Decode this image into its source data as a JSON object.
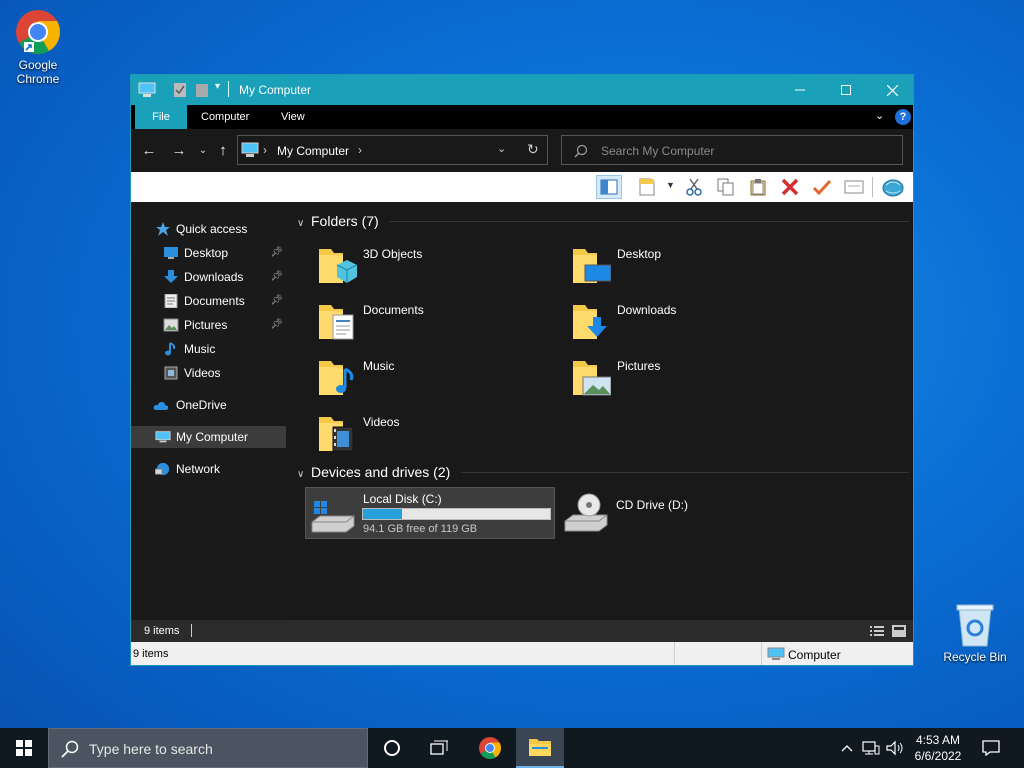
{
  "desktop": {
    "chrome_label": "Google Chrome",
    "recycle_label": "Recycle Bin"
  },
  "window": {
    "title": "My Computer",
    "ribbon_tabs": [
      {
        "label": "File",
        "active": true
      },
      {
        "label": "Computer",
        "active": false
      },
      {
        "label": "View",
        "active": false
      }
    ],
    "address": "My Computer",
    "search_placeholder": "Search My Computer",
    "nav": {
      "quick_access": "Quick access",
      "quick_items": [
        {
          "label": "Desktop",
          "icon": "desktop-icon",
          "pinned": true
        },
        {
          "label": "Downloads",
          "icon": "downloads-icon",
          "pinned": true
        },
        {
          "label": "Documents",
          "icon": "documents-icon",
          "pinned": true
        },
        {
          "label": "Pictures",
          "icon": "pictures-icon",
          "pinned": true
        },
        {
          "label": "Music",
          "icon": "music-icon",
          "pinned": false
        },
        {
          "label": "Videos",
          "icon": "videos-icon",
          "pinned": false
        }
      ],
      "onedrive": "OneDrive",
      "my_computer": "My Computer",
      "network": "Network"
    },
    "folders": {
      "heading": "Folders (7)",
      "items": [
        {
          "name": "3D Objects",
          "overlay": "cube"
        },
        {
          "name": "Desktop",
          "overlay": "monitor"
        },
        {
          "name": "Documents",
          "overlay": "doc"
        },
        {
          "name": "Downloads",
          "overlay": "arrow"
        },
        {
          "name": "Music",
          "overlay": "note"
        },
        {
          "name": "Pictures",
          "overlay": "picture"
        },
        {
          "name": "Videos",
          "overlay": "film"
        }
      ]
    },
    "drives": {
      "heading": "Devices and drives (2)",
      "items": [
        {
          "name": "Local Disk (C:)",
          "free_text": "94.1 GB free of 119 GB",
          "used_fraction": 0.21
        },
        {
          "name": "CD Drive (D:)"
        }
      ]
    },
    "status": {
      "item_count": "9 items",
      "item_count_bottom": "9 items",
      "location": "Computer"
    }
  },
  "taskbar": {
    "search_placeholder": "Type here to search",
    "time": "4:53 AM",
    "date": "6/6/2022"
  },
  "colors": {
    "accent": "#1aa0b8",
    "progress": "#26a0da"
  }
}
